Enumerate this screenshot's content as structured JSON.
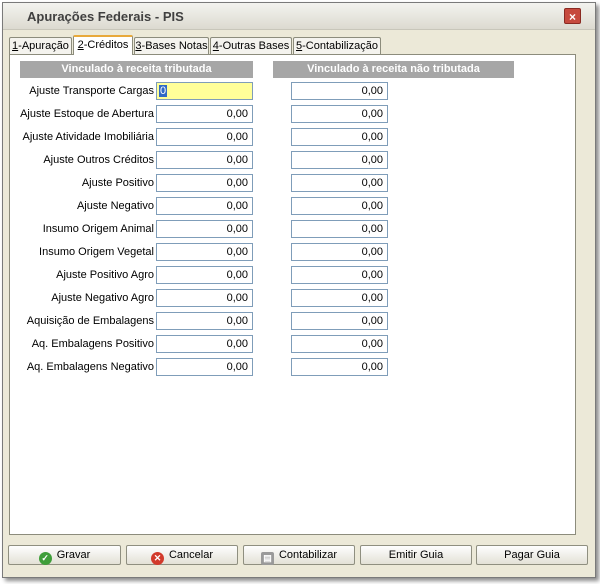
{
  "window": {
    "title": "Apurações Federais - PIS",
    "close_symbol": "×"
  },
  "tabs": [
    {
      "hotkey": "1",
      "label": "-Apuração",
      "active": false
    },
    {
      "hotkey": "2",
      "label": "-Créditos",
      "active": true
    },
    {
      "hotkey": "3",
      "label": "-Bases Notas",
      "active": false
    },
    {
      "hotkey": "4",
      "label": "-Outras Bases",
      "active": false
    },
    {
      "hotkey": "5",
      "label": "-Contabilização",
      "active": false
    }
  ],
  "columns": {
    "tributada": "Vinculado à receita tributada",
    "nao_tributada": "Vinculado à receita não tributada"
  },
  "rows": [
    {
      "label": "Ajuste Transporte Cargas",
      "tributada": "0",
      "nao_tributada": "0,00"
    },
    {
      "label": "Ajuste Estoque de Abertura",
      "tributada": "0,00",
      "nao_tributada": "0,00"
    },
    {
      "label": "Ajuste Atividade Imobiliária",
      "tributada": "0,00",
      "nao_tributada": "0,00"
    },
    {
      "label": "Ajuste Outros Créditos",
      "tributada": "0,00",
      "nao_tributada": "0,00"
    },
    {
      "label": "Ajuste Positivo",
      "tributada": "0,00",
      "nao_tributada": "0,00"
    },
    {
      "label": "Ajuste Negativo",
      "tributada": "0,00",
      "nao_tributada": "0,00"
    },
    {
      "label": "Insumo Origem Animal",
      "tributada": "0,00",
      "nao_tributada": "0,00"
    },
    {
      "label": "Insumo Origem Vegetal",
      "tributada": "0,00",
      "nao_tributada": "0,00"
    },
    {
      "label": "Ajuste Positivo Agro",
      "tributada": "0,00",
      "nao_tributada": "0,00"
    },
    {
      "label": "Ajuste Negativo Agro",
      "tributada": "0,00",
      "nao_tributada": "0,00"
    },
    {
      "label": "Aquisição de Embalagens",
      "tributada": "0,00",
      "nao_tributada": "0,00"
    },
    {
      "label": "Aq. Embalagens Positivo",
      "tributada": "0,00",
      "nao_tributada": "0,00"
    },
    {
      "label": "Aq. Embalagens Negativo",
      "tributada": "0,00",
      "nao_tributada": "0,00"
    }
  ],
  "buttons": {
    "gravar": "Gravar",
    "cancelar": "Cancelar",
    "contabilizar": "Contabilizar",
    "emitir_guia": "Emitir Guia",
    "pagar_guia": "Pagar Guia"
  },
  "colors": {
    "focused_field": "#ffff99",
    "column_header": "#a6a6a6",
    "active_tab_accent": "#e8a93b"
  }
}
